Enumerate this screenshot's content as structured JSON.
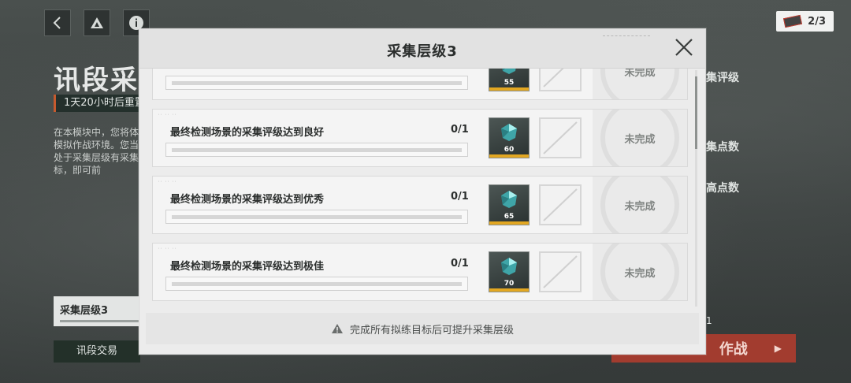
{
  "background": {
    "title": "讯段采",
    "reset_text": "1天20小时后重置",
    "description": "在本模块中，您将体的模拟作战环境。您当前处于采集层级有采集目标，即可前",
    "level_box_label": "采集层级3",
    "trade_button": "讯段交易",
    "counter": "2/3",
    "right_labels": [
      "集评级",
      "集点数",
      "高点数"
    ],
    "fight_button": "作战",
    "small_count": "1"
  },
  "modal": {
    "title": "采集层级3",
    "footer_text": "完成所有拟练目标后可提升采集层级",
    "tasks": [
      {
        "title": "",
        "progress": "",
        "reward_qty": "55",
        "status": "未完成"
      },
      {
        "title": "最终检测场景的采集评级达到良好",
        "progress": "0/1",
        "reward_qty": "60",
        "status": "未完成"
      },
      {
        "title": "最终检测场景的采集评级达到优秀",
        "progress": "0/1",
        "reward_qty": "65",
        "status": "未完成"
      },
      {
        "title": "最终检测场景的采集评级达到极佳",
        "progress": "0/1",
        "reward_qty": "70",
        "status": "未完成"
      }
    ]
  },
  "colors": {
    "reward_strip": "#e2a722",
    "fight_button": "#a23c2f",
    "reset_accent": "#c65a2e"
  },
  "icons": {
    "back": "chevron-left-icon",
    "drive": "triangle-logo-icon",
    "info": "info-icon",
    "close": "close-icon",
    "warning": "warning-icon",
    "reward": "crystal-gem-icon"
  }
}
